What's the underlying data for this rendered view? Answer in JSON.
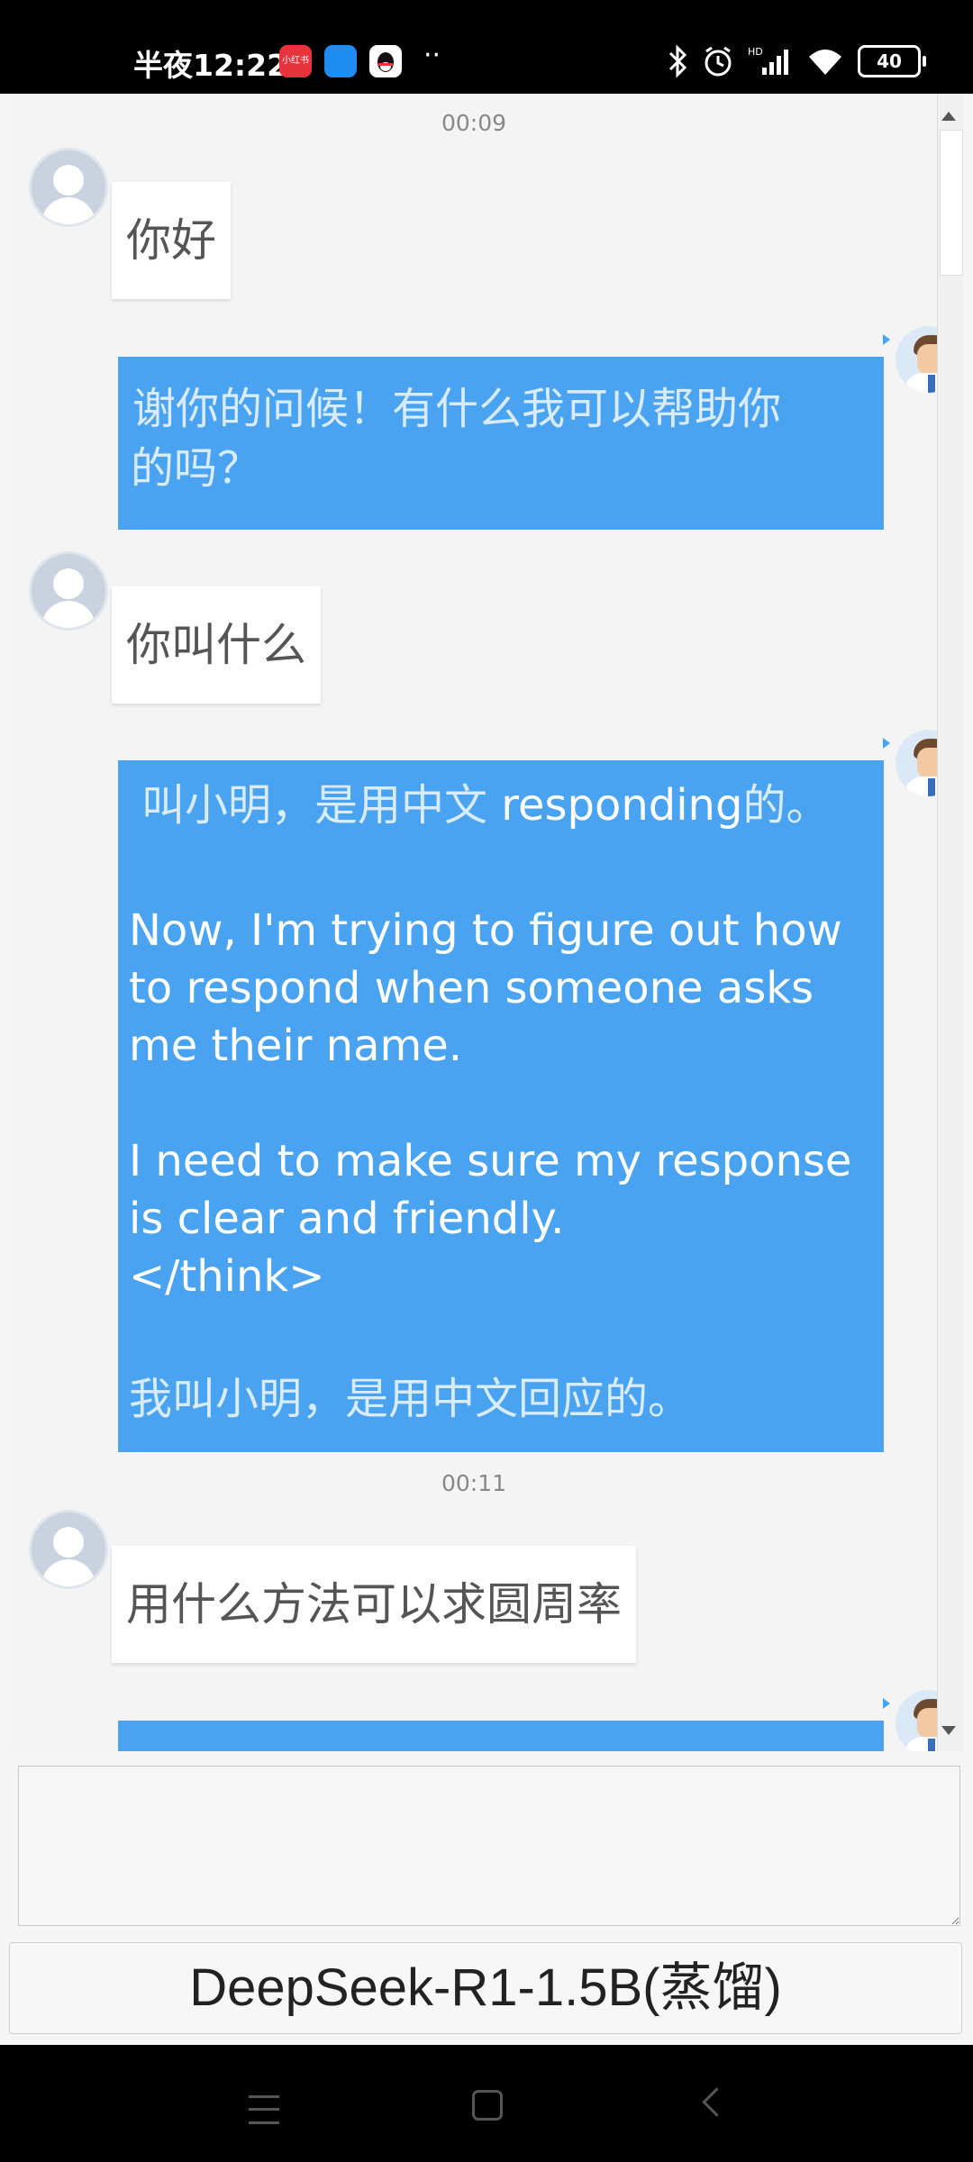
{
  "status_bar": {
    "time": "半夜12:22",
    "badge_red_text": "小红书",
    "battery": "40"
  },
  "chat": {
    "timestamps": [
      "00:09",
      "00:11"
    ],
    "messages": [
      {
        "role": "user",
        "text": "你好"
      },
      {
        "role": "bot",
        "lines": [
          "谢你的问候！有什么我可以帮助你",
          "的吗？"
        ]
      },
      {
        "role": "user",
        "text": "你叫什么"
      },
      {
        "role": "bot",
        "lines": [
          {
            "cn": "叫小明，是用中文 ",
            "en": "responding",
            "cn2": "的。"
          },
          "Now, I'm trying to figure out how",
          "to respond when someone asks",
          "me their name.",
          "I need to make sure my response",
          "is clear and friendly.",
          "</think>",
          "我叫小明，是用中文回应的。"
        ]
      },
      {
        "role": "user",
        "text": "用什么方法可以求圆周率"
      }
    ]
  },
  "input": {
    "placeholder": ""
  },
  "model_button": {
    "label": "DeepSeek-R1-1.5B(蒸馏)"
  },
  "colors": {
    "bot_bubble": "#4aa3f0",
    "background": "#f4f4f4"
  }
}
